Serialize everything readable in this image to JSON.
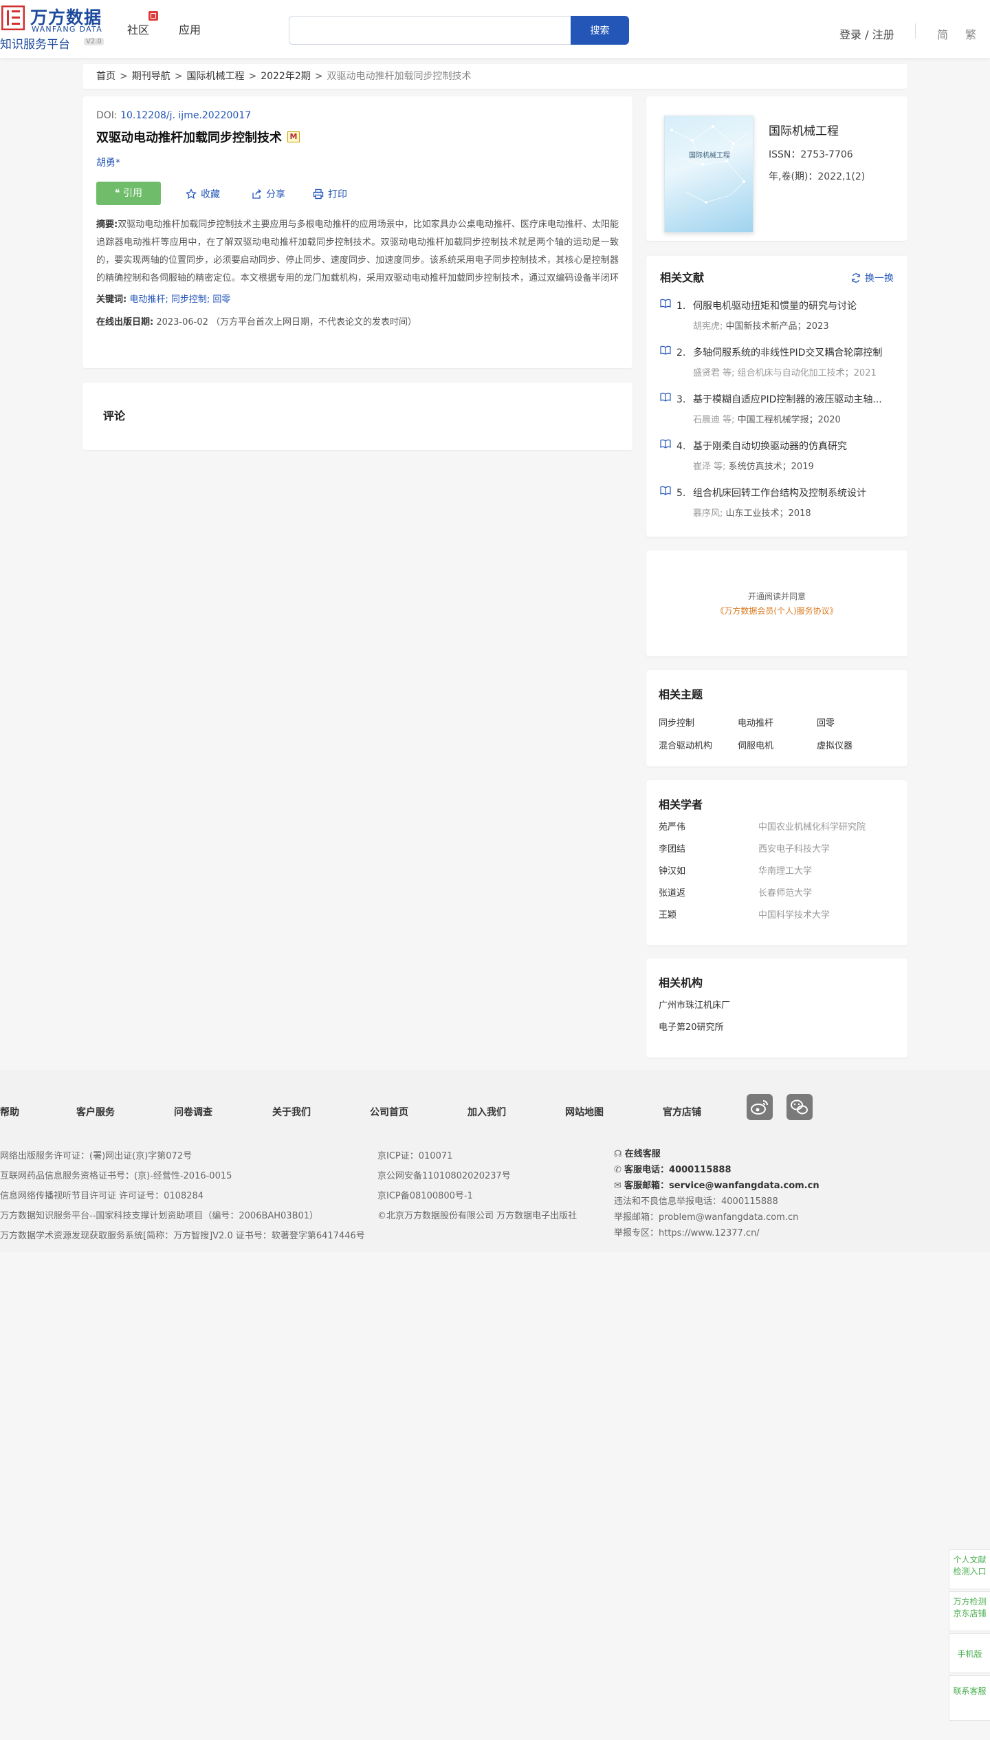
{
  "header": {
    "logo_cn": "万方数据",
    "logo_en": "WANFANG DATA",
    "logo_sub": "知识服务平台",
    "logo_ver": "V2.0",
    "nav": [
      "社区",
      "应用"
    ],
    "search_placeholder": "",
    "search_btn": "搜索",
    "login": "登录 / 注册",
    "lang": [
      "简",
      "繁"
    ]
  },
  "breadcrumb": {
    "items": [
      "首页",
      "期刊导航",
      "国际机械工程",
      "2022年2期"
    ],
    "current": "双驱动电动推杆加载同步控制技术",
    "sep": ">"
  },
  "article": {
    "doi_label": "DOI:",
    "doi_value": "10.12208/j. ijme.20220017",
    "title": "双驱动电动推杆加载同步控制技术",
    "author": "胡勇*",
    "cite": "引用",
    "collect": "收藏",
    "share": "分享",
    "print": "打印",
    "abstract_label": "摘要:",
    "abstract": "双驱动电动推杆加载同步控制技术主要应用与多根电动推杆的应用场景中，比如家具办公桌电动推杆、医疗床电动推杆、太阳能追踪器电动推杆等应用中，在了解双驱动电动推杆加载同步控制技术。双驱动电动推杆加载同步控制技术就是两个轴的运动是一致的，要实现两轴的位置同步，必须要启动同步、停止同步、速度同步、加速度同步。该系统采用电子同步控制技术，其核心是控制器的精确控制和各伺服轴的精密定位。本文根据专用的龙门加载机构，采用双驱动电动推杆加载同步控制技术，通过双编码设备半闭环控制方式、直线插补、同步超差三重冗余的软件保护控制、硬件超差等方式，完成...",
    "kw_label": "关键词:",
    "keywords": [
      "电动推杆;",
      "同步控制;",
      "回零"
    ],
    "date_label": "在线出版日期:",
    "date_value": "2023-06-02 （万方平台首次上网日期，不代表论文的发表时间）"
  },
  "comments": {
    "title": "评论"
  },
  "journal": {
    "cover_title": "国际机械工程",
    "name": "国际机械工程",
    "issn": "ISSN：2753-7706",
    "vol": "年,卷(期)：2022,1(2)"
  },
  "related": {
    "title": "相关文献",
    "refresh": "换一换",
    "items": [
      {
        "num": "1.",
        "title": "伺服电机驱动扭矩和惯量的研究与讨论",
        "authors": "胡宪虎;",
        "journal": "中国新技术新产品；2023"
      },
      {
        "num": "2.",
        "title": "多轴伺服系统的非线性PID交叉耦合轮廓控制",
        "authors": "盛贤君 等;",
        "journal": "组合机床与自动化加工技术；2021"
      },
      {
        "num": "3.",
        "title": "基于模糊自适应PID控制器的液压驱动主轴...",
        "authors": "石晨迪 等;",
        "journal": "中国工程机械学报；2020"
      },
      {
        "num": "4.",
        "title": "基于刚柔自动切换驱动器的仿真研究",
        "authors": "崔泽 等;",
        "journal": "系统仿真技术；2019"
      },
      {
        "num": "5.",
        "title": "组合机床回转工作台结构及控制系统设计",
        "authors": "慕序风;",
        "journal": "山东工业技术；2018"
      }
    ]
  },
  "agree": {
    "line1": "开通阅读并同意",
    "line2": "《万方数据会员(个人)服务协议》"
  },
  "topics": {
    "title": "相关主题",
    "items": [
      "同步控制",
      "电动推杆",
      "回零",
      "混合驱动机构",
      "伺服电机",
      "虚拟仪器"
    ]
  },
  "scholars": {
    "title": "相关学者",
    "items": [
      {
        "name": "苑严伟",
        "org": "中国农业机械化科学研究院"
      },
      {
        "name": "李团结",
        "org": "西安电子科技大学"
      },
      {
        "name": "钟汉如",
        "org": "华南理工大学"
      },
      {
        "name": "张道返",
        "org": "长春师范大学"
      },
      {
        "name": "王颖",
        "org": "中国科学技术大学"
      }
    ]
  },
  "orgs": {
    "title": "相关机构",
    "items": [
      "广州市珠江机床厂",
      "电子第20研究所"
    ]
  },
  "footer": {
    "links": [
      "帮助",
      "客户服务",
      "问卷调查",
      "关于我们",
      "公司首页",
      "加入我们",
      "网站地图",
      "官方店铺"
    ],
    "col1": [
      "网络出版服务许可证：(署)网出证(京)字第072号",
      "互联网药品信息服务资格证书号：(京)-经营性-2016-0015",
      "信息网络传播视听节目许可证 许可证号：0108284",
      "万方数据知识服务平台--国家科技支撑计划资助项目（编号：2006BAH03B01）",
      "万方数据学术资源发现获取服务系统[简称：万方智搜]V2.0 证书号：软著登字第6417446号"
    ],
    "col2": [
      "京ICP证：010071",
      "京公网安备11010802020237号",
      "京ICP备08100800号-1",
      "©北京万方数据股份有限公司 万方数据电子出版社"
    ],
    "col3_service_label": "在线客服",
    "col3_phone_label": "客服电话：",
    "col3_phone": "4000115888",
    "col3_email_label": "客服邮箱：",
    "col3_email": "service@wanfangdata.com.cn",
    "col3_lines": [
      "违法和不良信息举报电话：4000115888",
      "举报邮箱：problem@wanfangdata.com.cn",
      "举报专区：https://www.12377.cn/"
    ]
  },
  "float": [
    "个人文献检测入口",
    "万方检测京东店铺",
    "手机版",
    "联系客服"
  ],
  "colors": {
    "brand": "#1d4a9c",
    "primary": "#2456b8",
    "cite": "#6fbd6b",
    "float": "#4caf50"
  }
}
